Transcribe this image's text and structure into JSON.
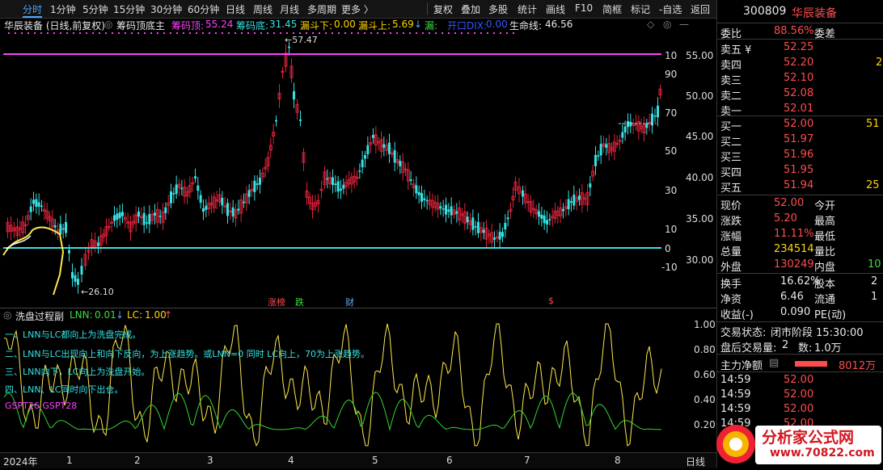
{
  "toolbar": {
    "periods": [
      "分时",
      "1分钟",
      "5分钟",
      "15分钟",
      "30分钟",
      "60分钟",
      "日线",
      "周线",
      "月线",
      "多周期",
      "更多 〉"
    ],
    "tools": [
      "复权",
      "叠加",
      "多股",
      "统计",
      "画线",
      "F10",
      "简框",
      "标记",
      "-自选",
      "返回"
    ]
  },
  "chart_header": {
    "stock_label": "华辰装备 (日线,前复权)",
    "indicator": "筹码顶底主",
    "top_label": "筹码顶:",
    "top_value": "55.24",
    "bottom_label": "筹码底:",
    "bottom_value": "31.45",
    "leak_down_label": "漏斗下:",
    "leak_down_value": "0.00",
    "leak_up_label": "漏斗上:",
    "leak_up_value": "5.69",
    "leak_label": "漏:",
    "kai_label": "开口DIX:",
    "kai_value": "0.00",
    "life_label": "生命线:",
    "life_value": "46.56",
    "high_marker": "57.47",
    "low_marker": "26.10"
  },
  "price_axis": [
    "55.00",
    "50.00",
    "45.00",
    "40.00",
    "35.00",
    "30.00"
  ],
  "osc_axis": [
    "10",
    "90",
    "70",
    "50",
    "30",
    "10",
    "0",
    "-10"
  ],
  "markers": {
    "m1": "涨榜",
    "m2": "跌",
    "m3": "财",
    "m4": "$"
  },
  "indicator_header": {
    "name": "洗盘过程副",
    "lnn_label": "LNN:",
    "lnn_value": "0.01",
    "lc_label": "LC:",
    "lc_value": "1.00"
  },
  "indicator_axis": [
    "1.00",
    "0.80",
    "0.60",
    "0.40",
    "0.20"
  ],
  "notes": [
    "一、LNN与LC都向上为洗盘完成。",
    "二、LNN与LC出现向上和向下反向，为上涨趋势。或LNN=0 同时 LC向上，70为上涨趋势。",
    "三、LNN向下，LC向上为洗盘开始。",
    "四、LNN、LC同时向下出仓。",
    "GSPT26  GSPT28"
  ],
  "x_axis": [
    "2024年",
    "1",
    "2",
    "3",
    "4",
    "5",
    "6",
    "7",
    "8"
  ],
  "x_axis_right": "日线",
  "panel": {
    "code": "300809",
    "name": "华辰装备",
    "weibi_label": "委比",
    "weibi_value": "88.56%",
    "weicha_label": "委差",
    "sell": [
      {
        "label": "卖五 ¥",
        "price": "52.25",
        "vol": ""
      },
      {
        "label": "卖四",
        "price": "52.20",
        "vol": "2"
      },
      {
        "label": "卖三",
        "price": "52.10",
        "vol": ""
      },
      {
        "label": "卖二",
        "price": "52.08",
        "vol": ""
      },
      {
        "label": "卖一",
        "price": "52.01",
        "vol": ""
      }
    ],
    "buy": [
      {
        "label": "买一",
        "price": "52.00",
        "vol": "51"
      },
      {
        "label": "买二",
        "price": "51.97",
        "vol": ""
      },
      {
        "label": "买三",
        "price": "51.96",
        "vol": ""
      },
      {
        "label": "买四",
        "price": "51.95",
        "vol": ""
      },
      {
        "label": "买五",
        "price": "51.94",
        "vol": "25"
      }
    ],
    "stats": [
      {
        "l1": "现价",
        "v1": "52.00",
        "l2": "今开"
      },
      {
        "l1": "涨跌",
        "v1": "5.20",
        "l2": "最高"
      },
      {
        "l1": "涨幅",
        "v1": "11.11%",
        "l2": "最低"
      },
      {
        "l1": "总量",
        "v1": "234514",
        "l2": "量比"
      },
      {
        "l1": "外盘",
        "v1": "130249",
        "l2": "内盘",
        "v2": "10"
      }
    ],
    "stats2": [
      {
        "l1": "换手",
        "v1": "16.62%",
        "l2": "股本",
        "v2": "2"
      },
      {
        "l1": "净资",
        "v1": "6.46",
        "l2": "流通",
        "v2": "1"
      },
      {
        "l1": "收益(-)",
        "v1": "0.090",
        "l2": "PE(动)"
      }
    ],
    "trade_status_label": "交易状态:",
    "trade_status": "闭市阶段 15:30:00",
    "after_label": "盘后交易量:",
    "after_value": "2",
    "after_amount_label": "数:",
    "after_amount": "1.0万",
    "flow_label": "主力净额",
    "flow_value": "8012万",
    "ticks": [
      {
        "time": "14:59",
        "price": "52.00"
      },
      {
        "time": "14:59",
        "price": "52.00"
      },
      {
        "time": "14:59",
        "price": "52.00"
      },
      {
        "time": "14:59",
        "price": "52.00"
      }
    ]
  },
  "logo": {
    "text": "分析家公式网",
    "url": "www.70822.com"
  }
}
